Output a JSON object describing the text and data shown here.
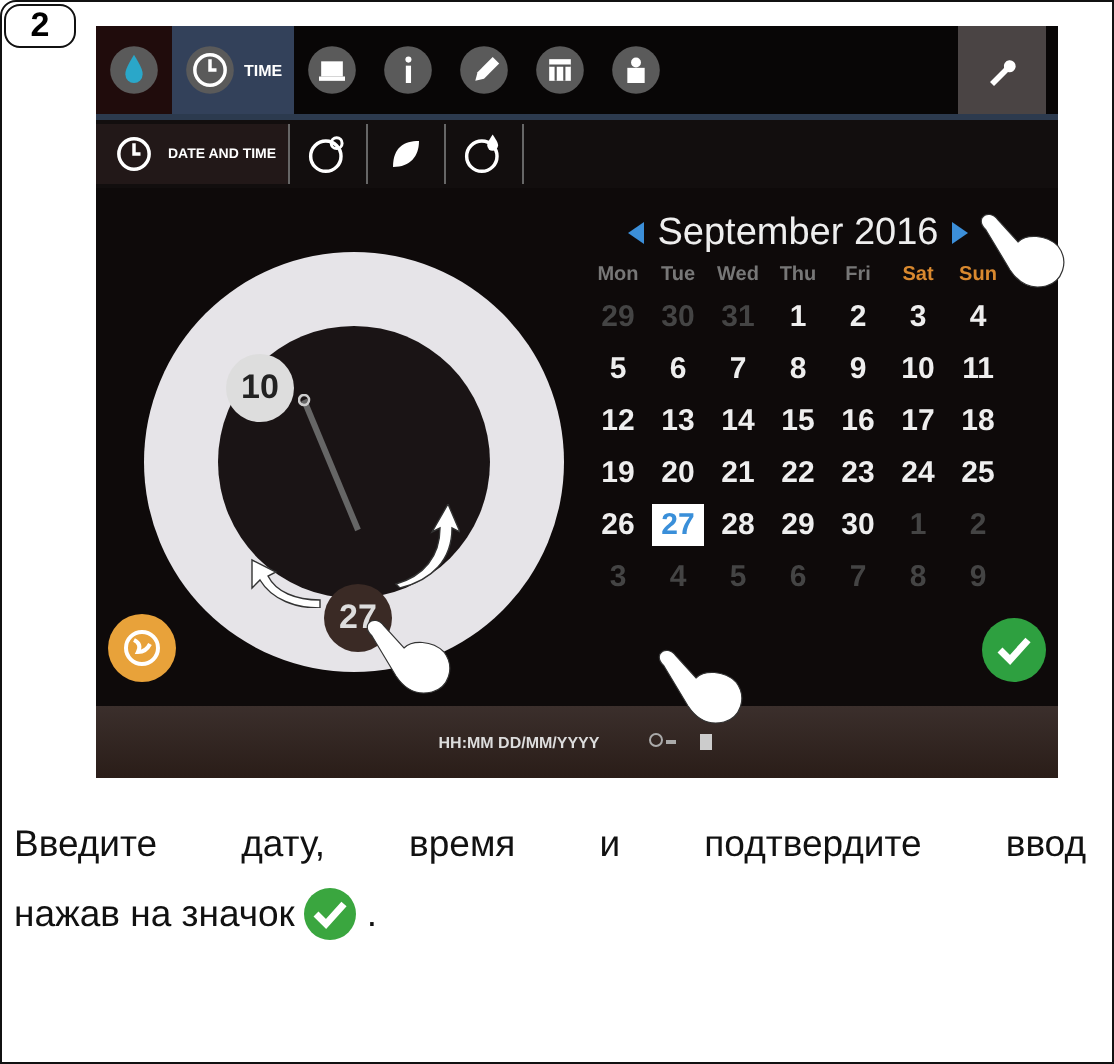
{
  "step_badge": "2",
  "toolbar": {
    "tabs": [
      {
        "selected": false
      },
      {
        "label": "TIME",
        "selected": true
      },
      {
        "selected": false
      },
      {
        "selected": false
      },
      {
        "selected": false
      },
      {
        "selected": false
      },
      {
        "selected": false
      }
    ]
  },
  "subtabs": [
    {
      "label": "DATE AND TIME",
      "selected": true
    },
    {
      "selected": false
    },
    {
      "selected": false
    },
    {
      "selected": false
    }
  ],
  "dial": {
    "hour": "10",
    "minute": "27"
  },
  "calendar": {
    "month": "September 2016",
    "weekdays": [
      {
        "label": "Mon",
        "weekend": false
      },
      {
        "label": "Tue",
        "weekend": false
      },
      {
        "label": "Wed",
        "weekend": false
      },
      {
        "label": "Thu",
        "weekend": false
      },
      {
        "label": "Fri",
        "weekend": false
      },
      {
        "label": "Sat",
        "weekend": true
      },
      {
        "label": "Sun",
        "weekend": true
      }
    ],
    "days": [
      {
        "label": "29",
        "muted": true,
        "selected": false
      },
      {
        "label": "30",
        "muted": true,
        "selected": false
      },
      {
        "label": "31",
        "muted": true,
        "selected": false
      },
      {
        "label": "1",
        "muted": false,
        "selected": false
      },
      {
        "label": "2",
        "muted": false,
        "selected": false
      },
      {
        "label": "3",
        "muted": false,
        "selected": false
      },
      {
        "label": "4",
        "muted": false,
        "selected": false
      },
      {
        "label": "5",
        "muted": false,
        "selected": false
      },
      {
        "label": "6",
        "muted": false,
        "selected": false
      },
      {
        "label": "7",
        "muted": false,
        "selected": false
      },
      {
        "label": "8",
        "muted": false,
        "selected": false
      },
      {
        "label": "9",
        "muted": false,
        "selected": false
      },
      {
        "label": "10",
        "muted": false,
        "selected": false
      },
      {
        "label": "11",
        "muted": false,
        "selected": false
      },
      {
        "label": "12",
        "muted": false,
        "selected": false
      },
      {
        "label": "13",
        "muted": false,
        "selected": false
      },
      {
        "label": "14",
        "muted": false,
        "selected": false
      },
      {
        "label": "15",
        "muted": false,
        "selected": false
      },
      {
        "label": "16",
        "muted": false,
        "selected": false
      },
      {
        "label": "17",
        "muted": false,
        "selected": false
      },
      {
        "label": "18",
        "muted": false,
        "selected": false
      },
      {
        "label": "19",
        "muted": false,
        "selected": false
      },
      {
        "label": "20",
        "muted": false,
        "selected": false
      },
      {
        "label": "21",
        "muted": false,
        "selected": false
      },
      {
        "label": "22",
        "muted": false,
        "selected": false
      },
      {
        "label": "23",
        "muted": false,
        "selected": false
      },
      {
        "label": "24",
        "muted": false,
        "selected": false
      },
      {
        "label": "25",
        "muted": false,
        "selected": false
      },
      {
        "label": "26",
        "muted": false,
        "selected": false
      },
      {
        "label": "27",
        "muted": false,
        "selected": true
      },
      {
        "label": "28",
        "muted": false,
        "selected": false
      },
      {
        "label": "29",
        "muted": false,
        "selected": false
      },
      {
        "label": "30",
        "muted": false,
        "selected": false
      },
      {
        "label": "1",
        "muted": true,
        "selected": false
      },
      {
        "label": "2",
        "muted": true,
        "selected": false
      },
      {
        "label": "3",
        "muted": true,
        "selected": false
      },
      {
        "label": "4",
        "muted": true,
        "selected": false
      },
      {
        "label": "5",
        "muted": true,
        "selected": false
      },
      {
        "label": "6",
        "muted": true,
        "selected": false
      },
      {
        "label": "7",
        "muted": true,
        "selected": false
      },
      {
        "label": "8",
        "muted": true,
        "selected": false
      },
      {
        "label": "9",
        "muted": true,
        "selected": false
      }
    ]
  },
  "status_bar": {
    "format": "HH:MM DD/MM/YYYY"
  },
  "instruction": {
    "lines": [
      "Введите дату, время и подтвердите ввод",
      "нажав на значок"
    ],
    "end": "."
  }
}
